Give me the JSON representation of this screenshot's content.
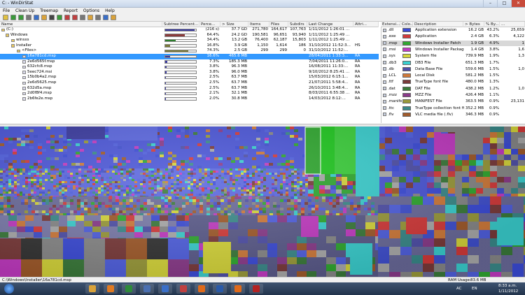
{
  "window": {
    "title": "C: - WinDirStat",
    "controls": [
      "–",
      "□",
      "✕"
    ]
  },
  "menu": [
    "File",
    "Clean Up",
    "Treemap",
    "Report",
    "Options",
    "Help"
  ],
  "toolbar_icons": [
    "open-icon",
    "refresh-icon",
    "refresh-all-icon",
    "copy-path-icon",
    "open-item-icon",
    "explorer-icon",
    "cmd-icon",
    "refresh-selected-icon",
    "delete-recycle-icon",
    "delete-icon",
    "properties-icon",
    "open-folder-icon",
    "select-all-icon",
    "help-icon",
    "info-icon"
  ],
  "tree_headers": [
    "Name",
    "Subtree Percent...",
    "Perce...",
    "> Size",
    "Items",
    "Files",
    "Subdirs",
    "Last Change",
    "Attri..."
  ],
  "tree_rows": [
    {
      "name": "(C:)",
      "pct": "(216 s)",
      "pctv": 0.95,
      "color": "#3a3aa0",
      "size": "37.7 GD",
      "items": "271,780",
      "files": "164,617",
      "subdirs": "107,763",
      "change": "1/11/2012 1:26:01 ...",
      "attr": ""
    },
    {
      "name": "Windows",
      "pct": "64.4%",
      "pctv": 0.644,
      "color": "#8a3a3a",
      "size": "24.2 GD",
      "items": "190,581",
      "files": "96,651",
      "subdirs": "93,940",
      "change": "1/11/2012 1:25:49 ...",
      "attr": ""
    },
    {
      "name": "winsxs",
      "pct": "34.4%",
      "pctv": 0.344,
      "color": "#2e7d2e",
      "size": "13.2 GB",
      "items": "76,400",
      "files": "62,187",
      "subdirs": "15,803",
      "change": "1/11/2012 1:25:49 ...",
      "attr": ""
    },
    {
      "name": "Installer",
      "pct": "16.8%",
      "pctv": 0.168,
      "color": "#7a7a3a",
      "size": "3.9 GB",
      "items": "1,150",
      "files": "1,614",
      "subdirs": "186",
      "change": "31/10/2012 11:52:3...",
      "attr": "HS"
    },
    {
      "name": "<Files>",
      "pct": "74.3%",
      "pctv": 0.743,
      "color": "#7a7a3a",
      "size": "2.5 GB",
      "items": "299",
      "files": "299",
      "subdirs": "0",
      "change": "31/10/2012 11:52:...",
      "attr": ""
    },
    {
      "name": "16a781cd.msp",
      "pct": "16.6%",
      "pctv": 0.166,
      "color": "#3a3aa0",
      "size": "465.6 MB",
      "items": "",
      "files": "",
      "subdirs": "",
      "change": "28/04/2011 1:33:3...",
      "attr": "RA"
    },
    {
      "name": "2e6d565f.msp",
      "pct": "7.3%",
      "pctv": 0.073,
      "color": "#3a3aa0",
      "size": "185.3 MB",
      "items": "",
      "files": "",
      "subdirs": "",
      "change": "7/04/2011 11:26:0...",
      "attr": "RA"
    },
    {
      "name": "632cfc8.msp",
      "pct": "3.8%",
      "pctv": 0.038,
      "color": "#3a3aa0",
      "size": "96.3 MB",
      "items": "",
      "files": "",
      "subdirs": "",
      "change": "16/08/2011 11:33:...",
      "attr": "RA"
    },
    {
      "name": "5eec724.msi",
      "pct": "3.8%",
      "pctv": 0.038,
      "color": "#3a3aa0",
      "size": "96.0 MB",
      "items": "",
      "files": "",
      "subdirs": "",
      "change": "9/10/2012 8:25:41 ...",
      "attr": "RA"
    },
    {
      "name": "15b0b4a2.msp",
      "pct": "2.5%",
      "pctv": 0.025,
      "color": "#3a3aa0",
      "size": "63.7 MB",
      "items": "",
      "files": "",
      "subdirs": "",
      "change": "15/03/2012 6:15:1...",
      "attr": "RA"
    },
    {
      "name": "2e6d5625.msp",
      "pct": "2.5%",
      "pctv": 0.025,
      "color": "#3a3aa0",
      "size": "63.7 MB",
      "items": "",
      "files": "",
      "subdirs": "",
      "change": "21/07/2011 5:58:4...",
      "attr": "RA"
    },
    {
      "name": "632d5a.msp",
      "pct": "2.5%",
      "pctv": 0.025,
      "color": "#3a3aa0",
      "size": "63.7 MB",
      "items": "",
      "files": "",
      "subdirs": "",
      "change": "26/10/2011 3:48:4...",
      "attr": "RA"
    },
    {
      "name": "2d0f8f4.msp",
      "pct": "2.1%",
      "pctv": 0.021,
      "color": "#3a3aa0",
      "size": "32.1 MB",
      "items": "",
      "files": "",
      "subdirs": "",
      "change": "8/03/2011 6:55:38 ...",
      "attr": "RA"
    },
    {
      "name": "2b6fe2e.msp",
      "pct": "2.0%",
      "pctv": 0.02,
      "color": "#3a3aa0",
      "size": "30.8 MB",
      "items": "",
      "files": "",
      "subdirs": "",
      "change": "14/03/2012 8:12:...",
      "attr": "RA"
    }
  ],
  "ext_headers": [
    "Extensi...",
    "Colo...",
    "Description",
    "> Bytes",
    "% By...",
    "..."
  ],
  "ext_rows": [
    {
      "ext": ".dll",
      "color": "#3b4bd8",
      "desc": "Application extension",
      "bytes": "16.2 GB",
      "pct": "43.2%",
      "more": "25,659"
    },
    {
      "ext": ".exe",
      "color": "#d43a3a",
      "desc": "Application",
      "bytes": "2.4 GB",
      "pct": "6.3%",
      "more": "4,122"
    },
    {
      "ext": ".msp",
      "color": "#2fa82f",
      "desc": "Windows Installer Patch",
      "bytes": "1.9 GB",
      "pct": "4.9%",
      "more": "1"
    },
    {
      "ext": ".msi",
      "color": "#c23ac2",
      "desc": "Windows Installer Package",
      "bytes": "1.4 GB",
      "pct": "3.8%",
      "more": "1,6"
    },
    {
      "ext": ".sys",
      "color": "#d6d63a",
      "desc": "System file",
      "bytes": "739.9 MB",
      "pct": "1.9%",
      "more": "1,3"
    },
    {
      "ext": ".db3",
      "color": "#3acfcf",
      "desc": "DB3 File",
      "bytes": "651.3 MB",
      "pct": "1.7%",
      "more": ""
    },
    {
      "ext": ".db",
      "color": "#4f4fa8",
      "desc": "Data Base File",
      "bytes": "559.6 MB",
      "pct": "1.5%",
      "more": "1,0"
    },
    {
      "ext": ".LCL",
      "color": "#d07a3a",
      "desc": "Local Disk",
      "bytes": "581.2 MB",
      "pct": "1.5%",
      "more": ""
    },
    {
      "ext": ".ttf",
      "color": "#7a3a3a",
      "desc": "TrueType font file",
      "bytes": "480.0 MB",
      "pct": "1.3%",
      "more": ""
    },
    {
      "ext": ".dat",
      "color": "#3a7a3a",
      "desc": "DAT File",
      "bytes": "438.2 MB",
      "pct": "1.2%",
      "more": "1,0"
    },
    {
      "ext": ".mzz",
      "color": "#8a3a8a",
      "desc": "MZZ File",
      "bytes": "426.4 MB",
      "pct": "1.1%",
      "more": ""
    },
    {
      "ext": ".manifest",
      "color": "#9a9a3a",
      "desc": "MANIFEST File",
      "bytes": "363.5 MB",
      "pct": "0.9%",
      "more": "23,131"
    },
    {
      "ext": ".ttc",
      "color": "#3a8a8a",
      "desc": "TrueType collection font file",
      "bytes": "352.2 MB",
      "pct": "0.9%",
      "more": ""
    },
    {
      "ext": ".flv",
      "color": "#a05a2a",
      "desc": "VLC media file (.flv)",
      "bytes": "346.3 MB",
      "pct": "0.9%",
      "more": ""
    }
  ],
  "status": {
    "path": "C:\\Windows\\Installer\\16a781cd.msp",
    "ram_label": "RAM Usage:",
    "ram_value": "83.6 MB"
  },
  "taskbar": {
    "start_icon": "windows-start-icon",
    "apps": [
      {
        "name": "explorer-icon",
        "color": "#d9a23a"
      },
      {
        "name": "media-player-icon",
        "color": "#e07a22"
      },
      {
        "name": "excel-icon",
        "color": "#2e8b3a"
      },
      {
        "name": "app-icon",
        "color": "#4a6fb0"
      },
      {
        "name": "outlook-icon",
        "color": "#3a6fc8"
      },
      {
        "name": "windirstat-icon",
        "color": "#c04040"
      },
      {
        "name": "firefox-icon",
        "color": "#e06a1a"
      },
      {
        "name": "word-icon",
        "color": "#2a5aa8"
      },
      {
        "name": "firefox-icon-2",
        "color": "#e06a1a"
      },
      {
        "name": "acrobat-icon",
        "color": "#b32222"
      }
    ],
    "lang": "EN",
    "tray_text": "AC",
    "time": "8:33 a.m.",
    "date": "1/11/2012"
  }
}
